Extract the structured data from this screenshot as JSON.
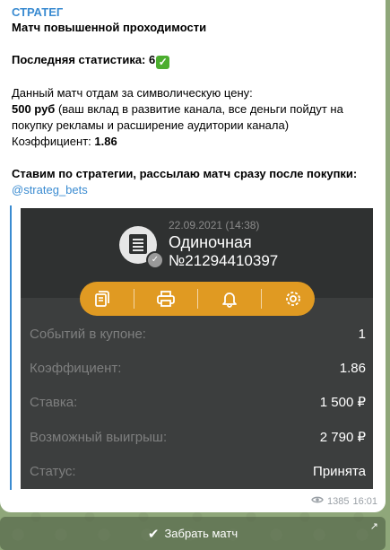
{
  "post": {
    "channel_name": "СТРАТЕГ",
    "title": "Матч повышенной проходимости",
    "stats_label": "Последняя статистика: 6",
    "intro": "Данный матч отдам за символическую цену:",
    "price": "500 руб",
    "price_note_1": " (ваш вклад в развитие канала, все деньги пойдут на",
    "price_note_2": "покупку рекламы и расширение аудитории канала)",
    "coef_label": "Коэффициент: ",
    "coef_value": "1.86",
    "strategy": "Ставим по стратегии, рассылаю матч сразу после покупки:",
    "link": "@strateg_bets",
    "views": "1385",
    "time": "16:01"
  },
  "coupon": {
    "date": "22.09.2021 (14:38)",
    "type": "Одиночная",
    "number": "№21294410397",
    "rows": [
      {
        "label": "Событий в купоне:",
        "value": "1"
      },
      {
        "label": "Коэффициент:",
        "value": "1.86"
      },
      {
        "label": "Ставка:",
        "value": "1 500 ₽"
      },
      {
        "label": "Возможный выигрыш:",
        "value": "2 790 ₽"
      },
      {
        "label": "Статус:",
        "value": "Принята"
      }
    ]
  },
  "action_button": {
    "label": "Забрать матч"
  },
  "icons": [
    "doc-icon",
    "check-badge-icon",
    "copy-icon",
    "print-icon",
    "bell-icon",
    "gear-icon",
    "eye-icon",
    "open-link-arrow-icon"
  ],
  "colors": {
    "accent": "#3a8bd1",
    "toolbar": "#e09a22",
    "check": "#4cae2f",
    "card": "#2f3131"
  }
}
